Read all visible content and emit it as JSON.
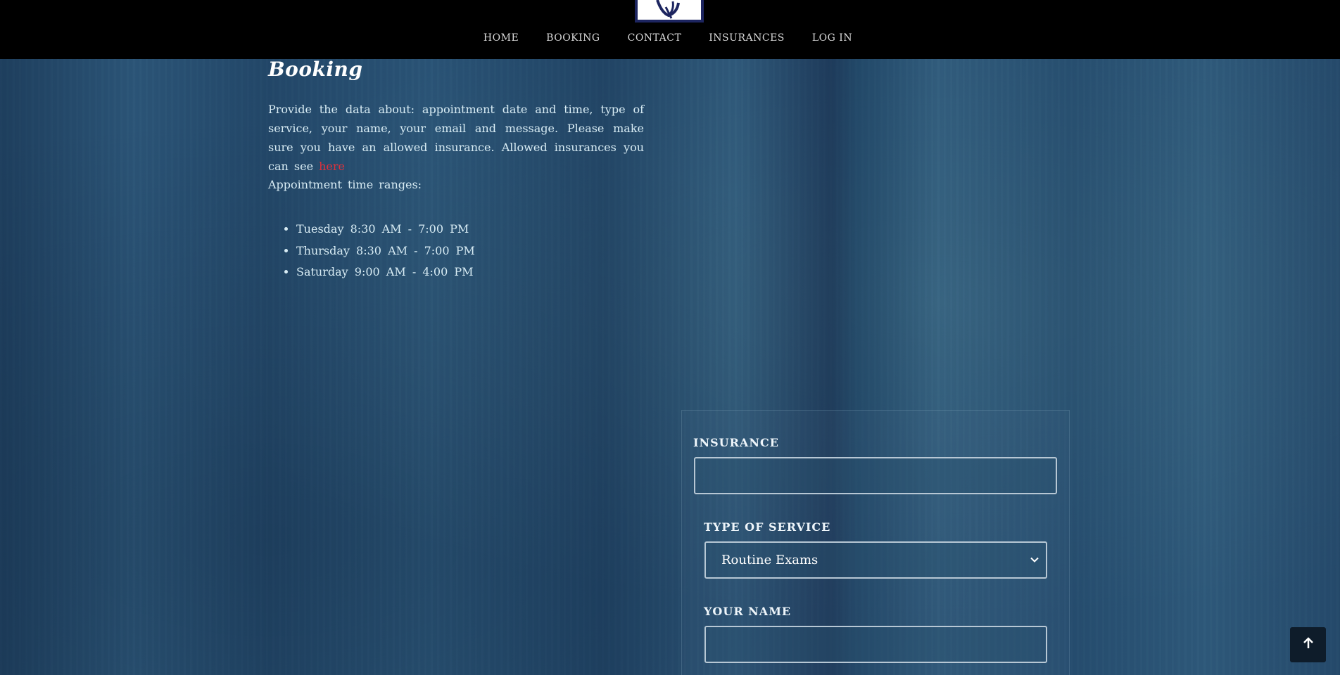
{
  "nav": {
    "items": [
      "HOME",
      "BOOKING",
      "CONTACT",
      "INSURANCES",
      "LOG IN"
    ]
  },
  "booking": {
    "title": "Booking",
    "intro_text": "Provide the data about: appointment date and time, type of service, your name, your email and message. Please make sure you have an allowed insurance. Allowed insurances you can see ",
    "intro_link": "here",
    "ranges_label": "Appointment time ranges:",
    "ranges": [
      "Tuesday 8:30 AM - 7:00 PM",
      "Thursday 8:30 AM - 7:00 PM",
      "Saturday 9:00 AM - 4:00 PM"
    ]
  },
  "form": {
    "insurance_label": "INSURANCE",
    "insurance_value": "",
    "service_label": "TYPE OF SERVICE",
    "service_value": "Routine Exams",
    "name_label": "YOUR NAME",
    "name_value": ""
  },
  "icons": {
    "logo": "logo-icon",
    "select_arrow": "chevron-down-icon",
    "back_to_top": "arrow-up-icon"
  },
  "colors": {
    "nav_bg": "#000000",
    "link": "#e0313a",
    "text": "#d8ecf4",
    "logo_border": "#1d2560"
  }
}
